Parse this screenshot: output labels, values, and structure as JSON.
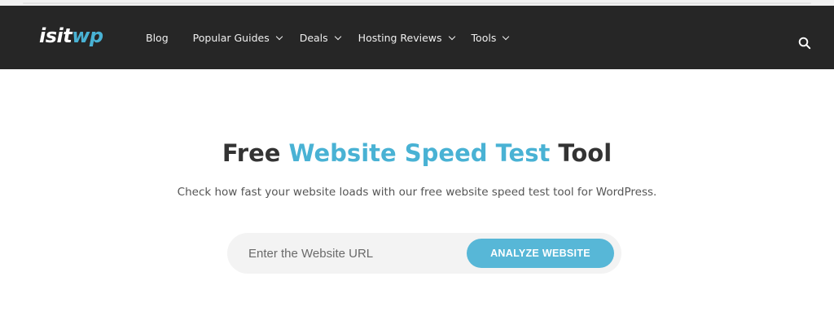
{
  "brand": {
    "logo_part1": "isit",
    "logo_part2": "wp",
    "accent_color": "#49b2d4",
    "navbar_color": "#262626"
  },
  "nav": {
    "items": [
      {
        "label": "Blog",
        "has_dropdown": false
      },
      {
        "label": "Popular Guides",
        "has_dropdown": true
      },
      {
        "label": "Deals",
        "has_dropdown": true
      },
      {
        "label": "Hosting Reviews",
        "has_dropdown": true
      },
      {
        "label": "Tools",
        "has_dropdown": true
      }
    ],
    "search_icon": "search-icon",
    "dropdown_icon": "chevron-down-icon"
  },
  "hero": {
    "title_prefix": "Free ",
    "title_highlight": "Website Speed Test",
    "title_suffix": " Tool",
    "subtitle": "Check how fast your website loads with our free website speed test tool for WordPress."
  },
  "form": {
    "url_placeholder": "Enter the Website URL",
    "url_value": "",
    "analyze_label": "ANALYZE WEBSITE",
    "button_color": "#57b7d7"
  }
}
